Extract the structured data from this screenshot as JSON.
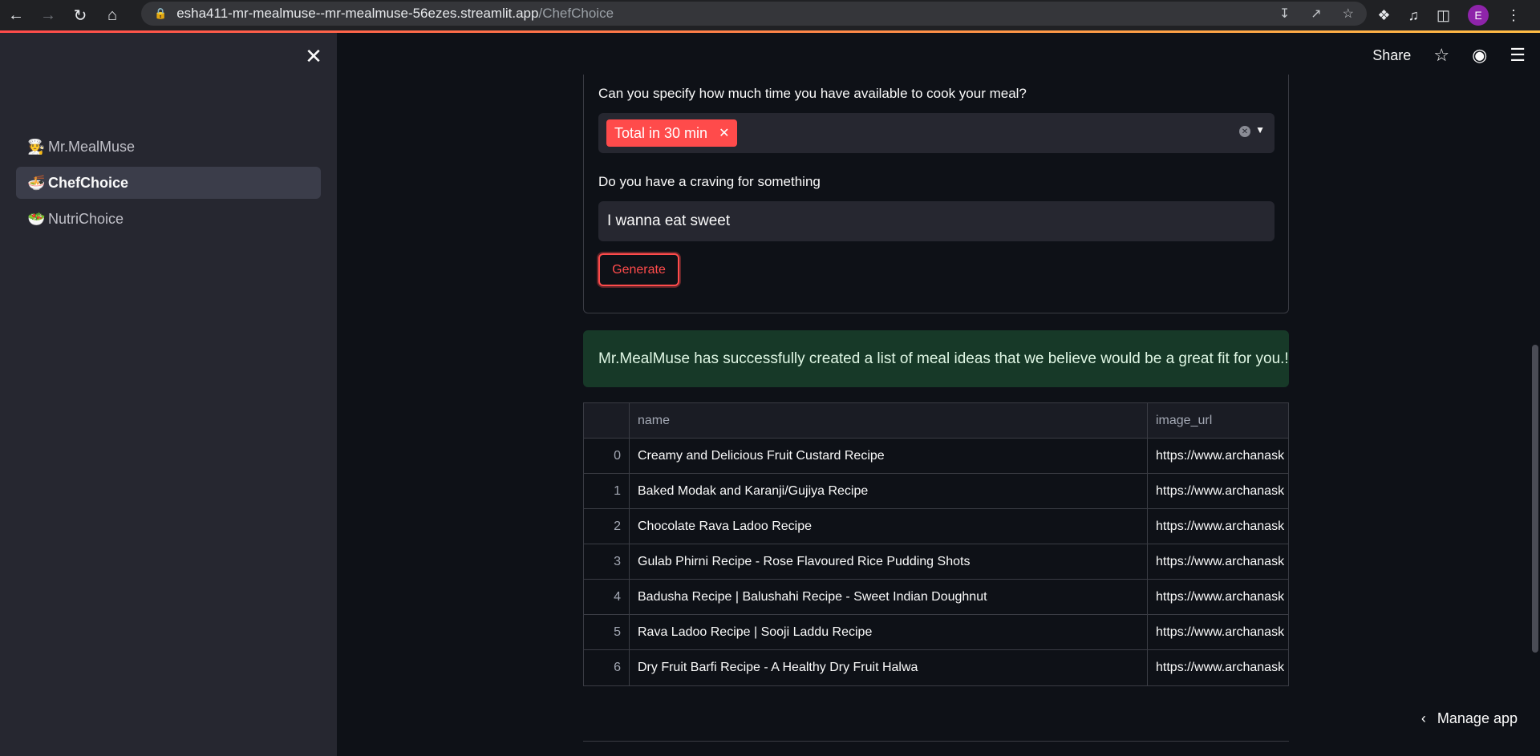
{
  "browser": {
    "url_host": "esha411-mr-mealmuse--mr-mealmuse-56ezes.streamlit.app",
    "url_path": "/ChefChoice",
    "avatar_letter": "E"
  },
  "sidebar": {
    "items": [
      {
        "emoji": "🧑‍🍳",
        "label": "Mr.MealMuse"
      },
      {
        "emoji": "🍜",
        "label": "ChefChoice"
      },
      {
        "emoji": "🥗",
        "label": "NutriChoice"
      }
    ]
  },
  "toolbar": {
    "share_label": "Share",
    "manage_app_label": "Manage app"
  },
  "form": {
    "time_question": "Can you specify how much time you have available to cook your meal?",
    "time_selected": "Total in 30 min",
    "craving_question": "Do you have a craving for something",
    "craving_value": "I wanna eat sweet",
    "generate_label": "Generate"
  },
  "success_message": "Mr.MealMuse has successfully created a list of meal ideas that we believe would be a great fit for you.!",
  "table": {
    "headers": {
      "name": "name",
      "image_url": "image_url"
    },
    "rows": [
      {
        "idx": "0",
        "name": "Creamy and Delicious Fruit Custard Recipe",
        "url": "https://www.archanask"
      },
      {
        "idx": "1",
        "name": "Baked Modak and Karanji/Gujiya Recipe",
        "url": "https://www.archanask"
      },
      {
        "idx": "2",
        "name": "Chocolate Rava Ladoo Recipe",
        "url": "https://www.archanask"
      },
      {
        "idx": "3",
        "name": "Gulab Phirni Recipe - Rose Flavoured Rice Pudding Shots",
        "url": "https://www.archanask"
      },
      {
        "idx": "4",
        "name": "Badusha Recipe | Balushahi Recipe - Sweet Indian Doughnut",
        "url": "https://www.archanask"
      },
      {
        "idx": "5",
        "name": "Rava Ladoo Recipe | Sooji Laddu Recipe",
        "url": "https://www.archanask"
      },
      {
        "idx": "6",
        "name": "Dry Fruit Barfi Recipe - A Healthy Dry Fruit Halwa",
        "url": "https://www.archanask"
      }
    ]
  },
  "colors": {
    "accent": "#ff4b4b",
    "success_bg": "#173928",
    "sidebar_bg": "#262730",
    "main_bg": "#0e1117"
  }
}
